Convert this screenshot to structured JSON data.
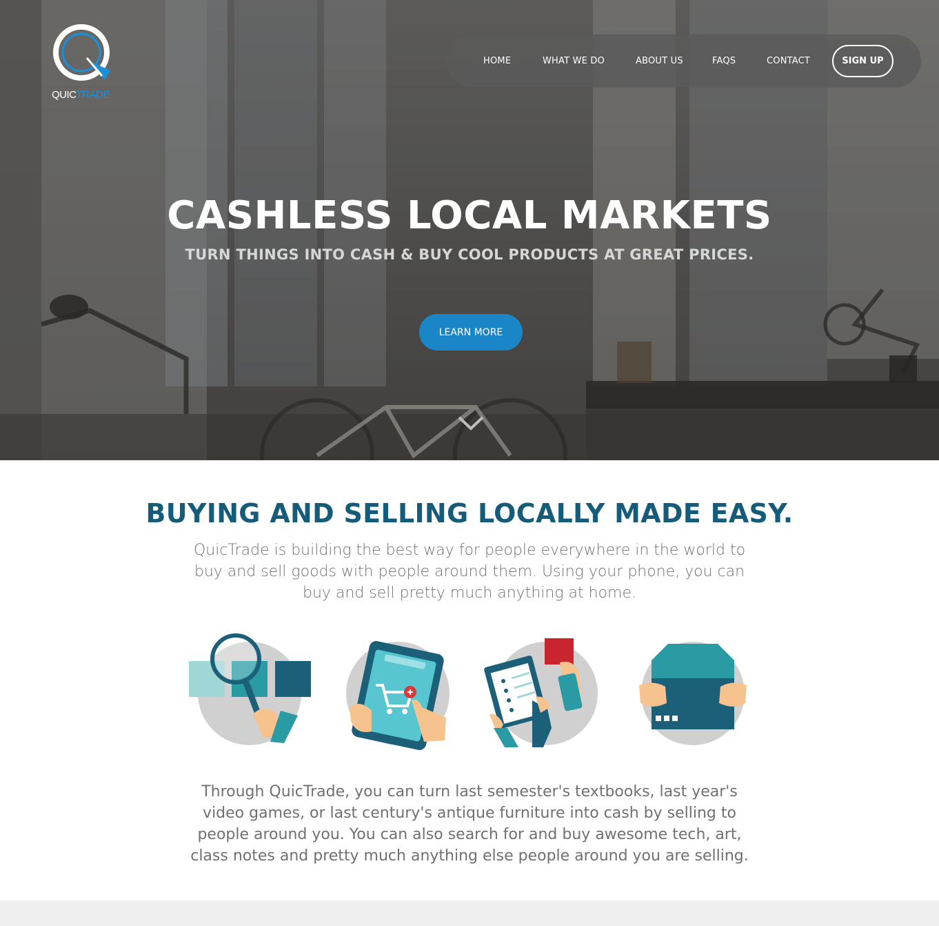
{
  "brand": {
    "name_part1": "QUIC",
    "name_part2": "TRADE",
    "accent": "#1b8fd9"
  },
  "nav": {
    "items": [
      {
        "label": "HOME"
      },
      {
        "label": "WHAT WE DO"
      },
      {
        "label": "ABOUT US"
      },
      {
        "label": "FAQS"
      },
      {
        "label": "CONTACT"
      }
    ],
    "signup_label": "SIGN UP"
  },
  "hero": {
    "title": "CASHLESS LOCAL MARKETS",
    "subtitle": "TURN THINGS INTO CASH & BUY COOL PRODUCTS AT GREAT PRICES.",
    "cta_label": "LEARN MORE",
    "scroll_icon": "chevron-down-icon"
  },
  "section": {
    "title": "BUYING AND SELLING LOCALLY MADE EASY.",
    "intro": "QuicTrade is building the best way for people everywhere in the world to buy and sell goods with people around them. Using your phone, you can buy and sell pretty much anything at home.",
    "icons": [
      "search-magnifier-icon",
      "tablet-cart-icon",
      "clipboard-payment-icon",
      "package-box-icon"
    ],
    "outro": "Through QuicTrade, you can turn last semester's textbooks, last year's video games, or last century's antique furniture into cash by selling to people around you. You can also search for and buy awesome tech, art, class notes and pretty much anything else people around you are selling."
  },
  "colors": {
    "title_blue": "#155b7a",
    "button_blue": "#1a86c8",
    "body_text": "#707070",
    "teal": "#2a9aa3",
    "dark_teal": "#1c5f78"
  }
}
